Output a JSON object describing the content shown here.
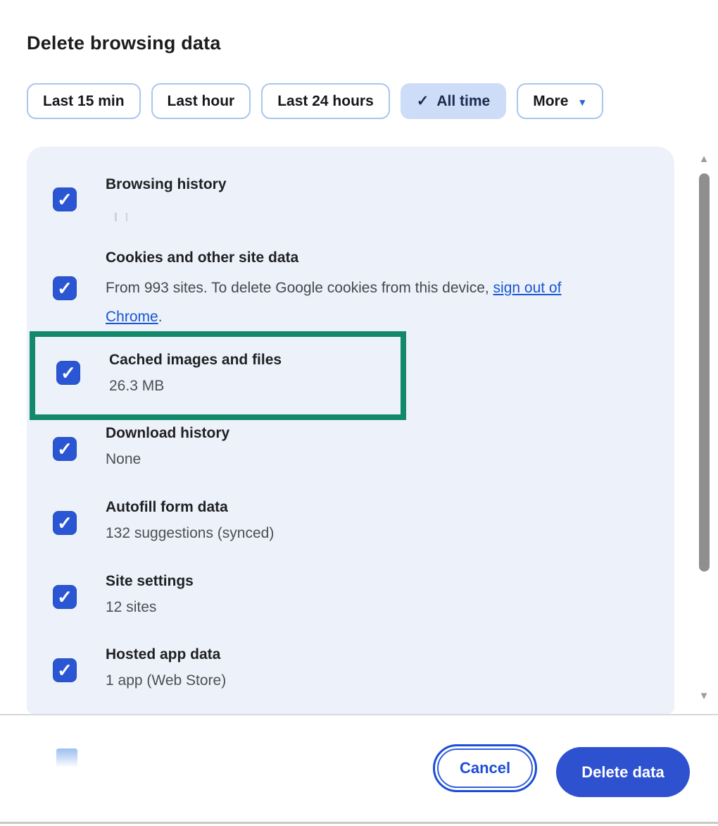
{
  "dialog": {
    "title": "Delete browsing data",
    "icons": {
      "chip_check": "✓",
      "more_dropdown": "▼",
      "checkbox_check": "✓",
      "scroll_up": "▲",
      "scroll_down": "▼"
    },
    "time_range_chips": [
      {
        "label": "Last 15 min",
        "selected": false
      },
      {
        "label": "Last hour",
        "selected": false
      },
      {
        "label": "Last 24 hours",
        "selected": false
      },
      {
        "label": "All time",
        "selected": true
      },
      {
        "label": "More",
        "selected": false
      }
    ],
    "items": [
      {
        "label": "Browsing history",
        "detail": "",
        "checked": true
      },
      {
        "label": "Cookies and other site data",
        "detail_prefix": "From 993 sites. To delete Google cookies from this device, ",
        "detail_link": "sign out of Chrome",
        "detail_suffix": ".",
        "checked": true
      },
      {
        "label": "Cached images and files",
        "detail": "26.3 MB",
        "checked": true,
        "highlighted": true
      },
      {
        "label": "Download history",
        "detail": "None",
        "checked": true
      },
      {
        "label": "Autofill form data",
        "detail": "132 suggestions (synced)",
        "checked": true
      },
      {
        "label": "Site settings",
        "detail": "12 sites",
        "checked": true
      },
      {
        "label": "Hosted app data",
        "detail": "1 app (Web Store)",
        "checked": true
      }
    ],
    "footer": {
      "cancel_label": "Cancel",
      "delete_label": "Delete data"
    },
    "colors": {
      "checkbox_blue": "#2a56d4",
      "selected_chip_bg": "#cdddf8",
      "chip_border": "#a9c6ef",
      "link_blue": "#1756d3",
      "delete_button_bg": "#2e51cf",
      "cancel_button_blue": "#1b4ed6",
      "annotation_green": "#12896a",
      "panel_bg": "#edf1f9"
    }
  }
}
